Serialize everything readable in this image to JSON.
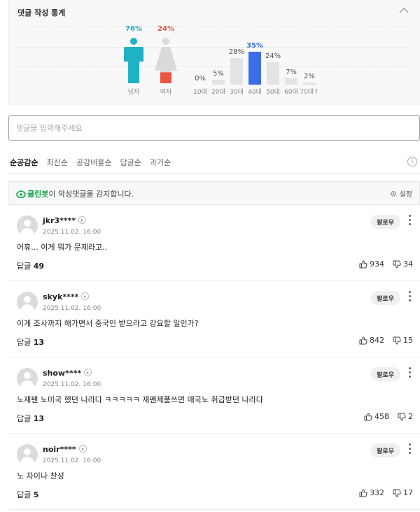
{
  "stats": {
    "title": "댓글 작성 통계",
    "gender": [
      {
        "label": "남자",
        "percent": "76%",
        "value": 76,
        "color": "#1fb1c4"
      },
      {
        "label": "여자",
        "percent": "24%",
        "value": 24,
        "color": "#e8543e"
      }
    ],
    "ages": [
      {
        "label": "10대",
        "percent": "0%",
        "value": 0
      },
      {
        "label": "20대",
        "percent": "5%",
        "value": 5
      },
      {
        "label": "30대",
        "percent": "28%",
        "value": 28
      },
      {
        "label": "40대",
        "percent": "35%",
        "value": 35,
        "highlight": true
      },
      {
        "label": "50대",
        "percent": "24%",
        "value": 24
      },
      {
        "label": "60대",
        "percent": "7%",
        "value": 7
      },
      {
        "label": "70대↑",
        "percent": "2%",
        "value": 2
      }
    ],
    "highlight_color": "#3c6de6"
  },
  "input": {
    "placeholder": "댓글을 입력해주세요"
  },
  "sort": {
    "tabs": [
      "순공감순",
      "최신순",
      "공감비율순",
      "답글순",
      "과거순"
    ],
    "active": 0
  },
  "cleanbot": {
    "brand": "클린봇",
    "message": "이 악성댓글을 감지합니다.",
    "settings_label": "설정",
    "brand_color": "#1aa34a"
  },
  "comments": [
    {
      "author": "jkr3****",
      "time": "2025.11.02. 16:00",
      "text": "어휴... 이게 뭐가 문제라고..",
      "reply_label": "답글",
      "reply_count": "49",
      "likes": "934",
      "dislikes": "34",
      "follow_label": "팔로우"
    },
    {
      "author": "skyk****",
      "time": "2025.11.02. 16:00",
      "text": "이게 조사까지 해가면서 중국인 받으라고 강요할 일인가?",
      "reply_label": "답글",
      "reply_count": "13",
      "likes": "842",
      "dislikes": "15",
      "follow_label": "팔로우"
    },
    {
      "author": "show****",
      "time": "2025.11.02. 16:00",
      "text": "노재팬 노미국 했던 나라다 ㅋㅋㅋㅋㅋ 재팬제품쓰면 매국노 취급받던 나라다",
      "reply_label": "답글",
      "reply_count": "13",
      "likes": "458",
      "dislikes": "2",
      "follow_label": "팔로우"
    },
    {
      "author": "noir****",
      "time": "2025.11.02. 16:00",
      "text": "노 차이나 찬성",
      "reply_label": "답글",
      "reply_count": "5",
      "likes": "332",
      "dislikes": "17",
      "follow_label": "팔로우"
    }
  ]
}
